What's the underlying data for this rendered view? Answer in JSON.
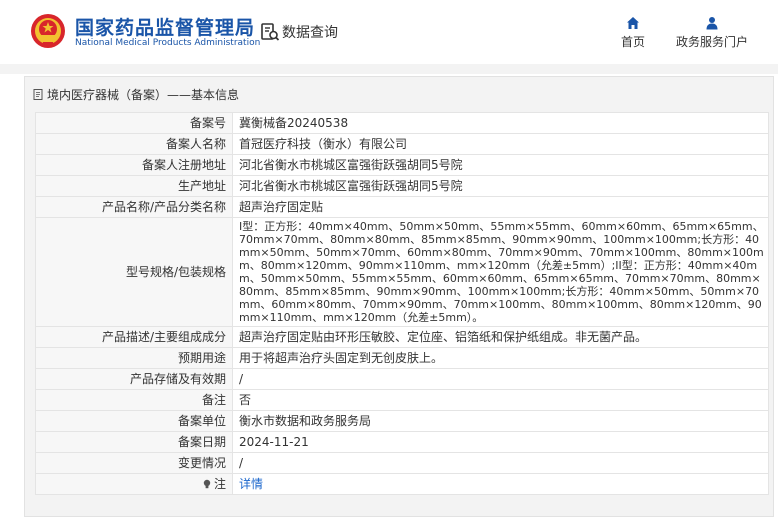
{
  "header": {
    "site_name": "国家药品监督管理局",
    "site_name_en": "National Medical Products Administration",
    "query_label": "数据查询",
    "nav": [
      {
        "label": "首页",
        "icon": "home-icon"
      },
      {
        "label": "政务服务门户",
        "icon": "user-icon"
      }
    ]
  },
  "panel": {
    "title": "境内医疗器械（备案）——基本信息"
  },
  "rows": [
    {
      "key": "备案号",
      "value": "冀衡械备20240538"
    },
    {
      "key": "备案人名称",
      "value": "首冠医疗科技（衡水）有限公司"
    },
    {
      "key": "备案人注册地址",
      "value": "河北省衡水市桃城区富强街跃强胡同5号院"
    },
    {
      "key": "生产地址",
      "value": "河北省衡水市桃城区富强街跃强胡同5号院"
    },
    {
      "key": "产品名称/产品分类名称",
      "value": "超声治疗固定贴"
    },
    {
      "key": "型号规格/包装规格",
      "value": "I型：正方形：40mm×40mm、50mm×50mm、55mm×55mm、60mm×60mm、65mm×65mm、70mm×70mm、80mm×80mm、85mm×85mm、90mm×90mm、100mm×100mm;长方形：40mm×50mm、50mm×70mm、60mm×80mm、70mm×90mm、70mm×100mm、80mm×100mm、80mm×120mm、90mm×110mm、mm×120mm（允差±5mm）;II型：正方形：40mm×40mm、50mm×50mm、55mm×55mm、60mm×60mm、65mm×65mm、70mm×70mm、80mm×80mm、85mm×85mm、90mm×90mm、100mm×100mm;长方形：40mm×50mm、50mm×70mm、60mm×80mm、70mm×90mm、70mm×100mm、80mm×100mm、80mm×120mm、90mm×110mm、mm×120mm（允差±5mm）。"
    },
    {
      "key": "产品描述/主要组成成分",
      "value": "超声治疗固定贴由环形压敏胶、定位座、铝箔纸和保护纸组成。非无菌产品。"
    },
    {
      "key": "预期用途",
      "value": "用于将超声治疗头固定到无创皮肤上。"
    },
    {
      "key": "产品存储及有效期",
      "value": "/"
    },
    {
      "key": "备注",
      "value": "否"
    },
    {
      "key": "备案单位",
      "value": "衡水市数据和政务服务局"
    },
    {
      "key": "备案日期",
      "value": "2024-11-21"
    },
    {
      "key": "变更情况",
      "value": "/"
    },
    {
      "key": "注",
      "value": "详情"
    }
  ],
  "colors": {
    "brand_blue": "#1a55a8",
    "link_blue": "#1a66cc"
  }
}
